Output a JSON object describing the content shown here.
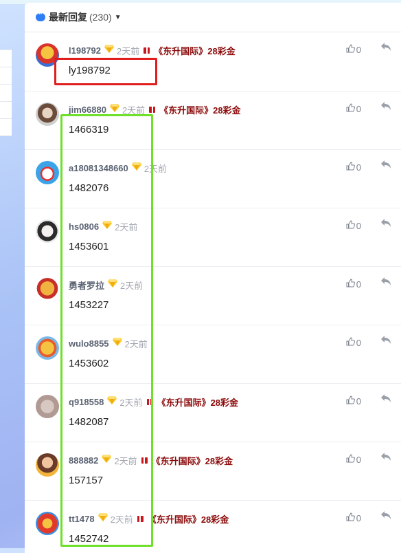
{
  "header": {
    "title": "最新回复",
    "count": "(230)",
    "icon": "chat-bubble-icon"
  },
  "colors": {
    "accent": "#2e7cf6",
    "title_red": "#8b0a0a",
    "gift_red": "#c8161d",
    "highlight_red": "#e21d1d",
    "highlight_green": "#6fe02a"
  },
  "comments": [
    {
      "username": "l198792",
      "time": "2天前",
      "title": "《东升国际》28彩金",
      "content": "ly198792",
      "likes": "0"
    },
    {
      "username": "jim66880",
      "time": "2天前",
      "title": "《东升国际》28彩金",
      "content": "1466319",
      "likes": "0"
    },
    {
      "username": "a18081348660",
      "time": "2天前",
      "title": "",
      "content": "1482076",
      "likes": "0"
    },
    {
      "username": "hs0806",
      "time": "2天前",
      "title": "",
      "content": "1453601",
      "likes": "0"
    },
    {
      "username": "勇者罗拉",
      "time": "2天前",
      "title": "",
      "content": "1453227",
      "likes": "0"
    },
    {
      "username": "wulo8855",
      "time": "2天前",
      "title": "",
      "content": "1453602",
      "likes": "0"
    },
    {
      "username": "q918558",
      "time": "2天前",
      "title": "《东升国际》28彩金",
      "content": "1482087",
      "likes": "0"
    },
    {
      "username": "888882",
      "time": "2天前",
      "title": "《东升国际》28彩金",
      "content": "157157",
      "likes": "0"
    },
    {
      "username": "tt1478",
      "time": "2天前",
      "title": "《东升国际》28彩金",
      "content": "1452742",
      "likes": "0"
    }
  ]
}
